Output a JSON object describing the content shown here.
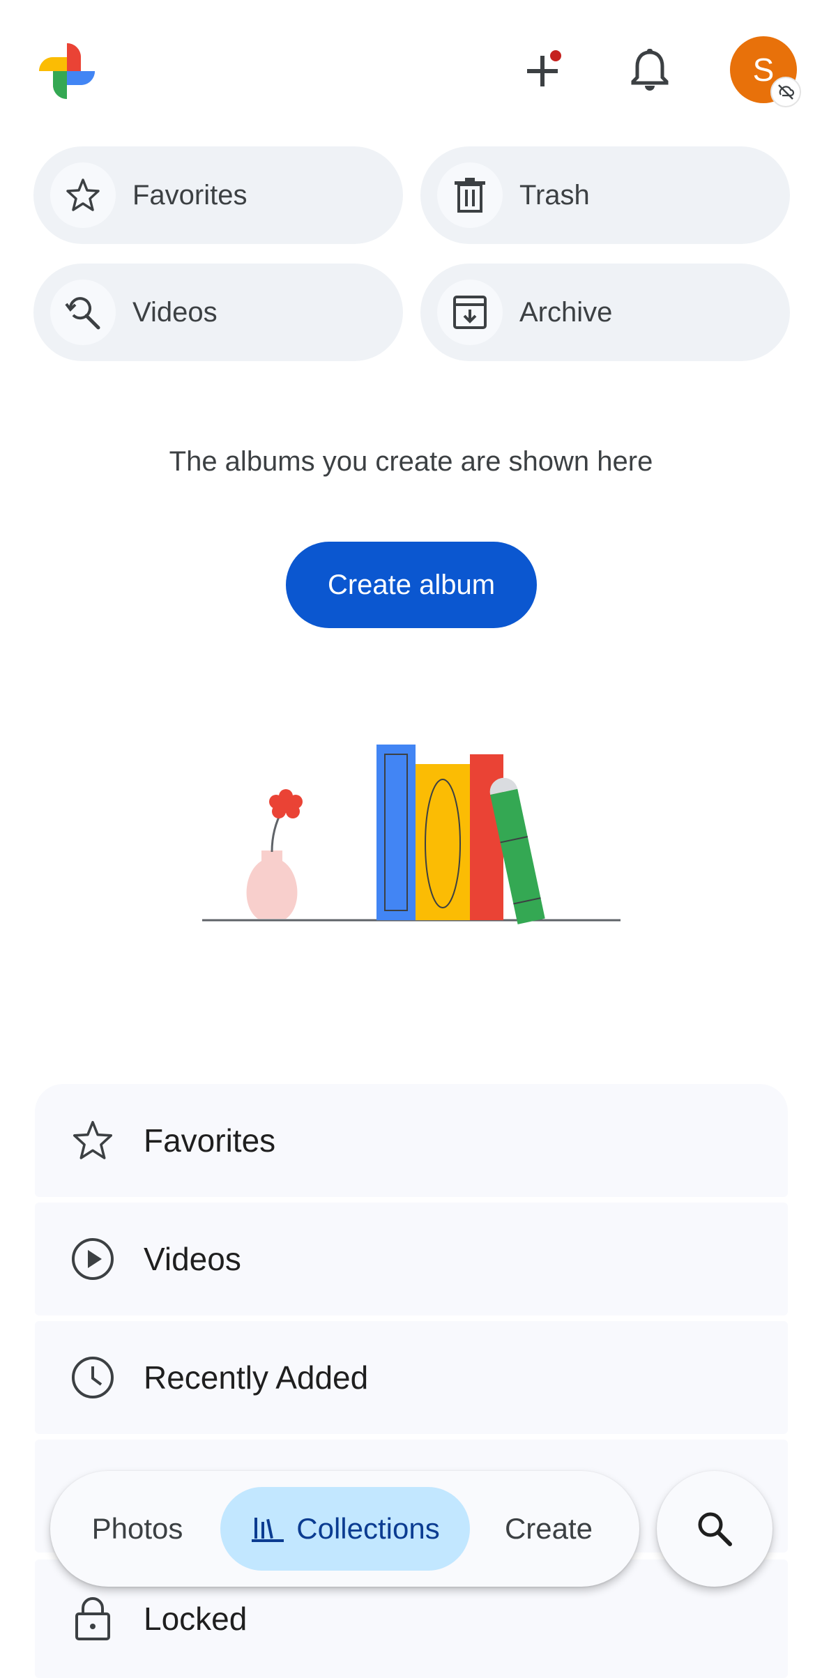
{
  "header": {
    "avatar_initial": "S",
    "accent_notification_dot": "#c5221f",
    "avatar_color": "#e8710a"
  },
  "quick_chips": [
    {
      "label": "Favorites",
      "icon": "star-icon"
    },
    {
      "label": "Trash",
      "icon": "trash-icon"
    },
    {
      "label": "Videos",
      "icon": "search-history-icon"
    },
    {
      "label": "Archive",
      "icon": "archive-icon"
    }
  ],
  "empty_state": {
    "message": "The albums you create are shown here",
    "button_label": "Create album"
  },
  "collections_list": [
    {
      "label": "Favorites",
      "icon": "star-icon"
    },
    {
      "label": "Videos",
      "icon": "play-circle-icon"
    },
    {
      "label": "Recently Added",
      "icon": "clock-icon"
    },
    {
      "label": "",
      "icon": ""
    },
    {
      "label": "Locked",
      "icon": "lock-icon"
    }
  ],
  "bottom_nav": {
    "photos": "Photos",
    "collections": "Collections",
    "create": "Create",
    "active": "Collections",
    "active_color": "#c2e7ff"
  },
  "colors": {
    "primary_button": "#0b57d0",
    "chip_bg": "#eff2f6",
    "list_bg": "#f8f9fd"
  }
}
